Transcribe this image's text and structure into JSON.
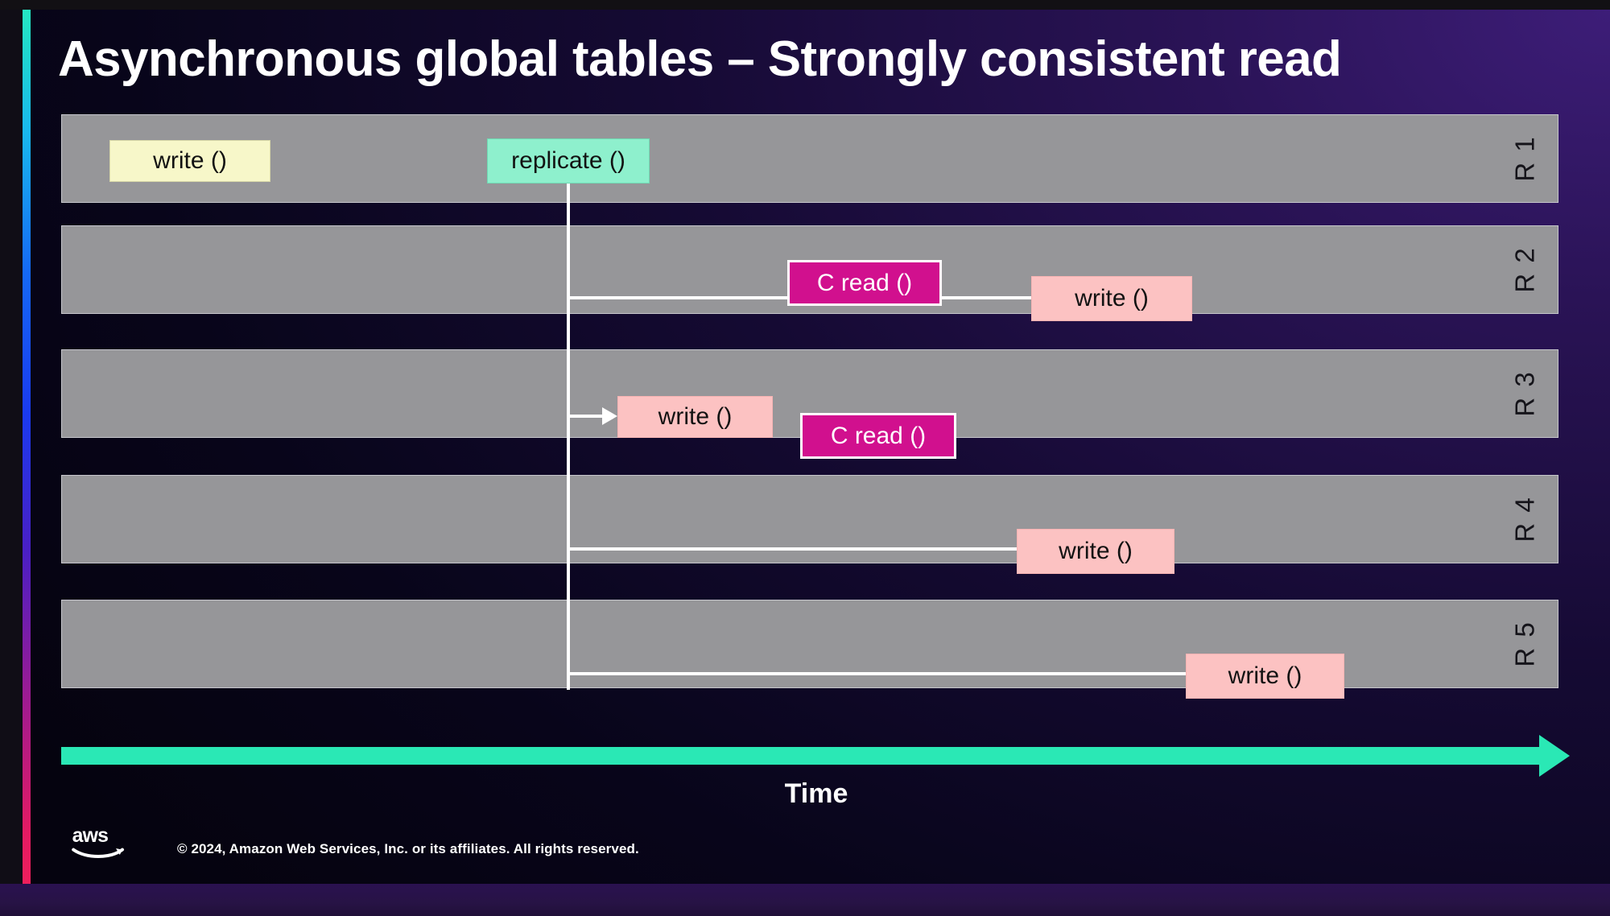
{
  "slide": {
    "title": "Asynchronous global tables – Strongly consistent read",
    "time_axis_label": "Time",
    "copyright": "© 2024, Amazon Web Services, Inc. or its affiliates. All rights reserved.",
    "logo_name": "aws"
  },
  "colors": {
    "row_fill": "#969699",
    "write_yellow": "#f7f7c9",
    "replicate_teal": "#8ef0cd",
    "write_pink": "#fcc2c2",
    "consistent_read_magenta": "#d1108e",
    "time_axis_teal": "#2ae8b5",
    "accent_top": "#25e8c4",
    "accent_bottom": "#ef1f5c",
    "slide_background": "#150a33",
    "connector_line": "#ffffff"
  },
  "rows": [
    {
      "label": "R 1"
    },
    {
      "label": "R 2"
    },
    {
      "label": "R 3"
    },
    {
      "label": "R 4"
    },
    {
      "label": "R 5"
    }
  ],
  "operations": {
    "r1_write": "write ()",
    "r1_replicate": "replicate ()",
    "r2_consistent_read": "C read ()",
    "r2_write": "write ()",
    "r3_write": "write ()",
    "r3_consistent_read": "C read ()",
    "r4_write": "write ()",
    "r5_write": "write ()"
  }
}
